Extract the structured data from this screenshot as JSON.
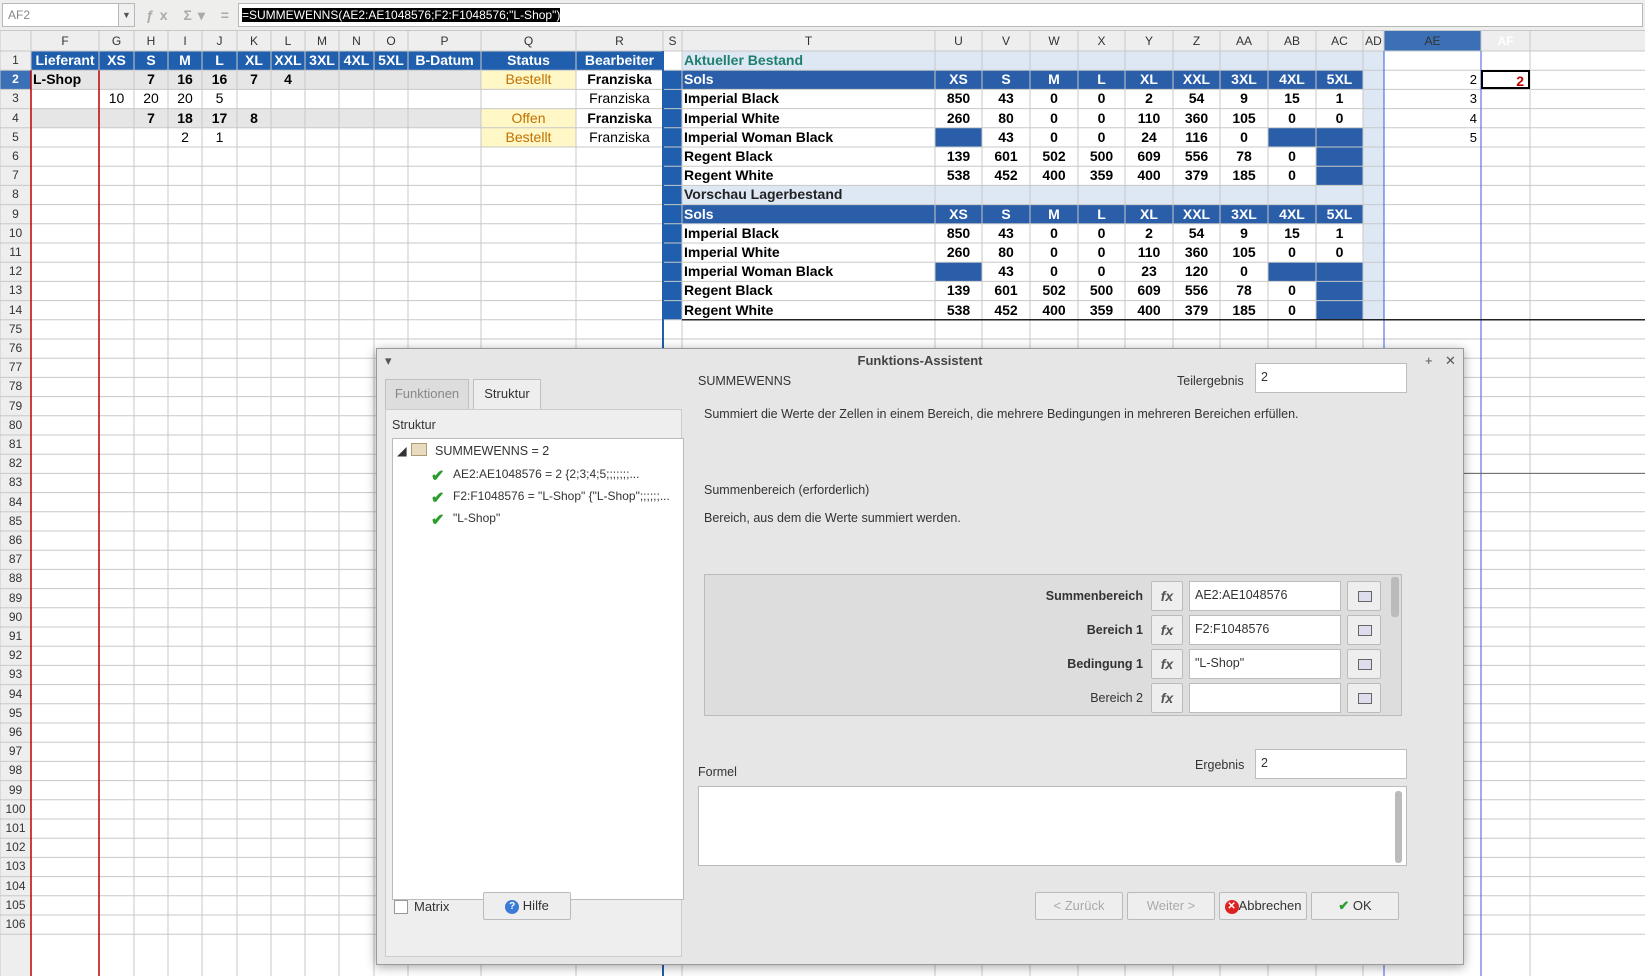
{
  "namebox": "AF2",
  "formula": "=SUMMEWENNS(AE2:AE1048576;F2:F1048576;\"L-Shop\")",
  "formula_eq": "=",
  "formula_sel": "SUMMEWENNS(AE2:AE1048576;F2:F1048576;\"L-Shop\")",
  "col_letters": [
    "F",
    "G",
    "H",
    "I",
    "J",
    "K",
    "L",
    "M",
    "N",
    "O",
    "P",
    "Q",
    "R",
    "S",
    "T",
    "U",
    "V",
    "W",
    "X",
    "Y",
    "Z",
    "AA",
    "AB",
    "AC",
    "AD",
    "AE",
    "AF"
  ],
  "row_numbers": [
    "1",
    "2",
    "3",
    "4",
    "5",
    "6",
    "7",
    "8",
    "9",
    "10",
    "11",
    "12",
    "13",
    "14",
    "75",
    "76",
    "77",
    "78",
    "79",
    "80",
    "81",
    "82",
    "83",
    "84",
    "85",
    "86",
    "87",
    "88",
    "89",
    "90",
    "91",
    "92",
    "93",
    "94",
    "95",
    "96",
    "97",
    "98",
    "99",
    "100",
    "101",
    "102",
    "103",
    "104",
    "105",
    "106"
  ],
  "left_headers": [
    "Lieferant",
    "XS",
    "S",
    "M",
    "L",
    "XL",
    "XXL",
    "3XL",
    "4XL",
    "5XL",
    "B-Datum",
    "Status",
    "Bearbeiter"
  ],
  "left_rows": [
    [
      "L-Shop",
      "",
      "7",
      "16",
      "16",
      "7",
      "4",
      "",
      "",
      "",
      "",
      "Bestellt",
      "Franziska"
    ],
    [
      "",
      "10",
      "20",
      "20",
      "5",
      "",
      "",
      "",
      "",
      "",
      "",
      "",
      "Franziska"
    ],
    [
      "",
      "",
      "7",
      "18",
      "17",
      "8",
      "",
      "",
      "",
      "",
      "",
      "Offen",
      "Franziska"
    ],
    [
      "",
      "",
      "",
      "2",
      "1",
      "",
      "",
      "",
      "",
      "",
      "",
      "Bestellt",
      "Franziska"
    ]
  ],
  "stock_title": "Aktueller Bestand",
  "preview_title": "Vorschau Lagerbestand",
  "stock_headers": [
    "Sols",
    "XS",
    "S",
    "M",
    "L",
    "XL",
    "XXL",
    "3XL",
    "4XL",
    "5XL"
  ],
  "stock_rows": [
    [
      "Imperial Black",
      "850",
      "43",
      "0",
      "0",
      "2",
      "54",
      "9",
      "15",
      "1"
    ],
    [
      "Imperial White",
      "260",
      "80",
      "0",
      "0",
      "110",
      "360",
      "105",
      "0",
      "0"
    ],
    [
      "Imperial Woman Black",
      "",
      "43",
      "0",
      "0",
      "24",
      "116",
      "0",
      "",
      ""
    ],
    [
      "Regent Black",
      "139",
      "601",
      "502",
      "500",
      "609",
      "556",
      "78",
      "0",
      ""
    ],
    [
      "Regent White",
      "538",
      "452",
      "400",
      "359",
      "400",
      "379",
      "185",
      "0",
      ""
    ]
  ],
  "preview_rows": [
    [
      "Imperial Black",
      "850",
      "43",
      "0",
      "0",
      "2",
      "54",
      "9",
      "15",
      "1"
    ],
    [
      "Imperial White",
      "260",
      "80",
      "0",
      "0",
      "110",
      "360",
      "105",
      "0",
      "0"
    ],
    [
      "Imperial Woman Black",
      "",
      "43",
      "0",
      "0",
      "23",
      "120",
      "0",
      "",
      ""
    ],
    [
      "Regent Black",
      "139",
      "601",
      "502",
      "500",
      "609",
      "556",
      "78",
      "0",
      ""
    ],
    [
      "Regent White",
      "538",
      "452",
      "400",
      "359",
      "400",
      "379",
      "185",
      "0",
      ""
    ]
  ],
  "ae_values": [
    "2",
    "3",
    "4",
    "5"
  ],
  "af_value": "2",
  "dialog": {
    "title": "Funktions-Assistent",
    "tab_functions": "Funktionen",
    "tab_structure": "Struktur",
    "structure_label": "Struktur",
    "tree_root": "SUMMEWENNS = 2",
    "tree_items": [
      "AE2:AE1048576 = 2  {2;3;4;5;;;;;;;...",
      "F2:F1048576 = \"L-Shop\"  {\"L-Shop\";;;;;;...",
      "\"L-Shop\""
    ],
    "func_name": "SUMMEWENNS",
    "subtotal_label": "Teilergebnis",
    "subtotal_value": "2",
    "description": "Summiert die Werte der Zellen in einem Bereich, die mehrere Bedingungen in mehreren Bereichen erfüllen.",
    "param_title": "Summenbereich (erforderlich)",
    "param_desc": "Bereich, aus dem die Werte summiert werden.",
    "args": [
      {
        "label": "Summenbereich",
        "value": "AE2:AE1048576"
      },
      {
        "label": "Bereich 1",
        "value": "F2:F1048576"
      },
      {
        "label": "Bedingung 1",
        "value": "\"L-Shop\""
      },
      {
        "label": "Bereich 2",
        "value": ""
      }
    ],
    "result_label": "Ergebnis",
    "result_value": "2",
    "formula_label": "Formel",
    "matrix_label": "Matrix",
    "help": "Hilfe",
    "back": "< Zurück",
    "next": "Weiter >",
    "cancel": "Abbrechen",
    "ok": "OK"
  }
}
